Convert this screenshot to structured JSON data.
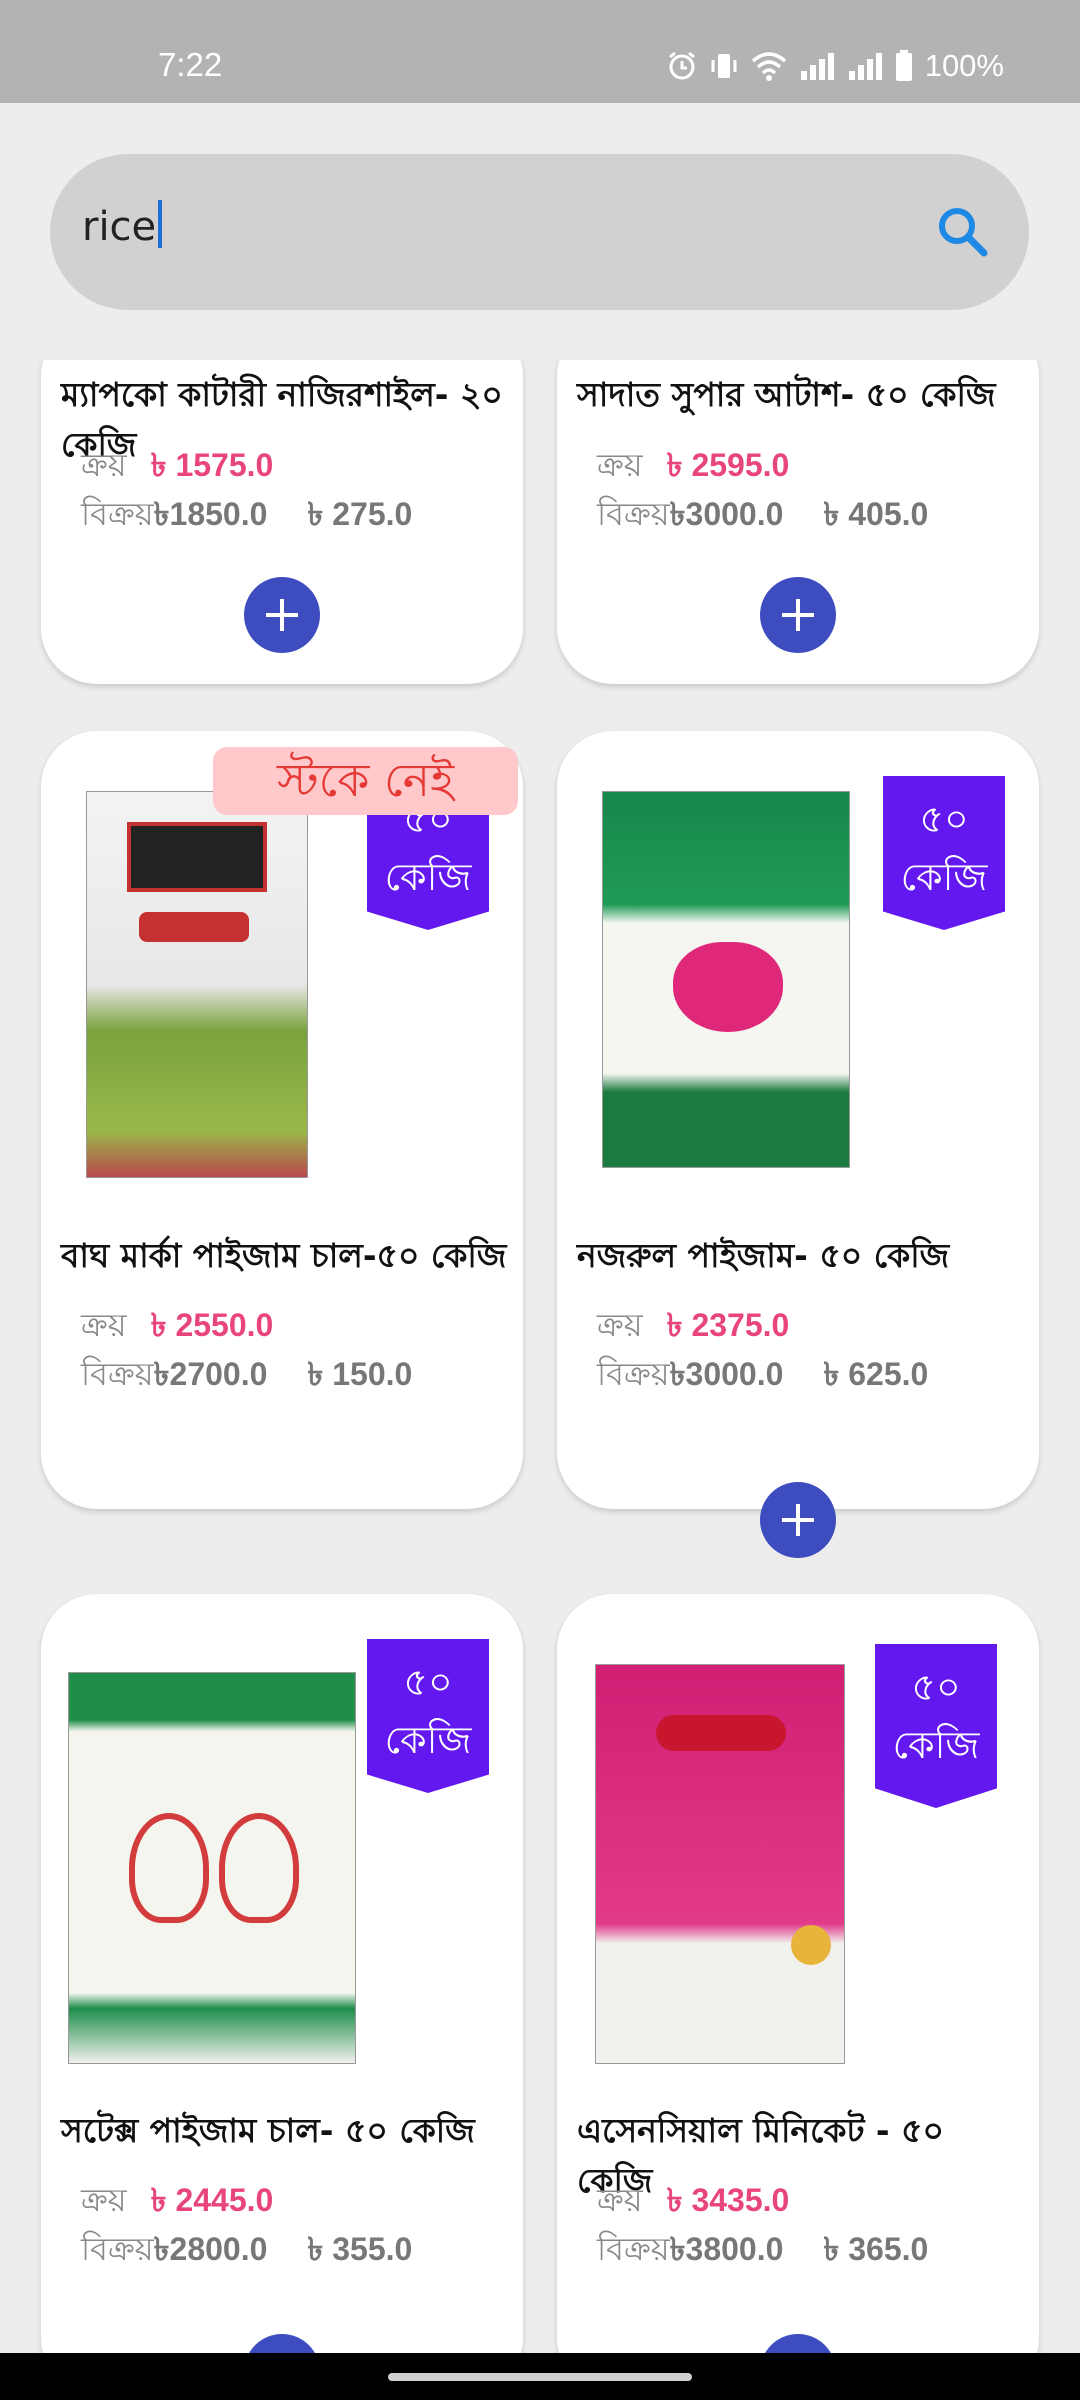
{
  "status": {
    "time": "7:22",
    "battery": "100%"
  },
  "search": {
    "query": "rice"
  },
  "labels": {
    "buy": "ক্রয়",
    "sell": "বিক্রয়",
    "out_of_stock": "স্টকে নেই"
  },
  "products": [
    {
      "title": "ম্যাপকো কাটারী নাজিরশাইল- ২০ কেজি",
      "buy": "৳ 1575.0",
      "sell": "৳1850.0",
      "profit": "৳ 275.0"
    },
    {
      "title": "সাদাত সুপার আটাশ- ৫০ কেজি",
      "buy": "৳ 2595.0",
      "sell": "৳3000.0",
      "profit": "৳ 405.0"
    },
    {
      "title": "বাঘ মার্কা পাইজাম চাল-৫০ কেজি",
      "buy": "৳ 2550.0",
      "sell": "৳2700.0",
      "profit": "৳ 150.0",
      "weight": "৫০ কেজি",
      "stock": "out"
    },
    {
      "title": "নজরুল পাইজাম- ৫০ কেজি",
      "buy": "৳ 2375.0",
      "sell": "৳3000.0",
      "profit": "৳ 625.0",
      "weight": "৫০ কেজি"
    },
    {
      "title": "সটেক্স  পাইজাম চাল- ৫০ কেজি",
      "buy": "৳ 2445.0",
      "sell": "৳2800.0",
      "profit": "৳ 355.0",
      "weight": "৫০ কেজি"
    },
    {
      "title": "এসেনসিয়াল মিনিকেট - ৫০ কেজি",
      "buy": "৳ 3435.0",
      "sell": "৳3800.0",
      "profit": "৳ 365.0",
      "weight": "৫০ কেজি"
    }
  ],
  "colors": {
    "accent": "#3d4cbf",
    "buy_price": "#e8467a",
    "weight_tag": "#6418f0",
    "out_of_stock_bg": "#ffc9cc",
    "out_of_stock_text": "#e53935"
  }
}
